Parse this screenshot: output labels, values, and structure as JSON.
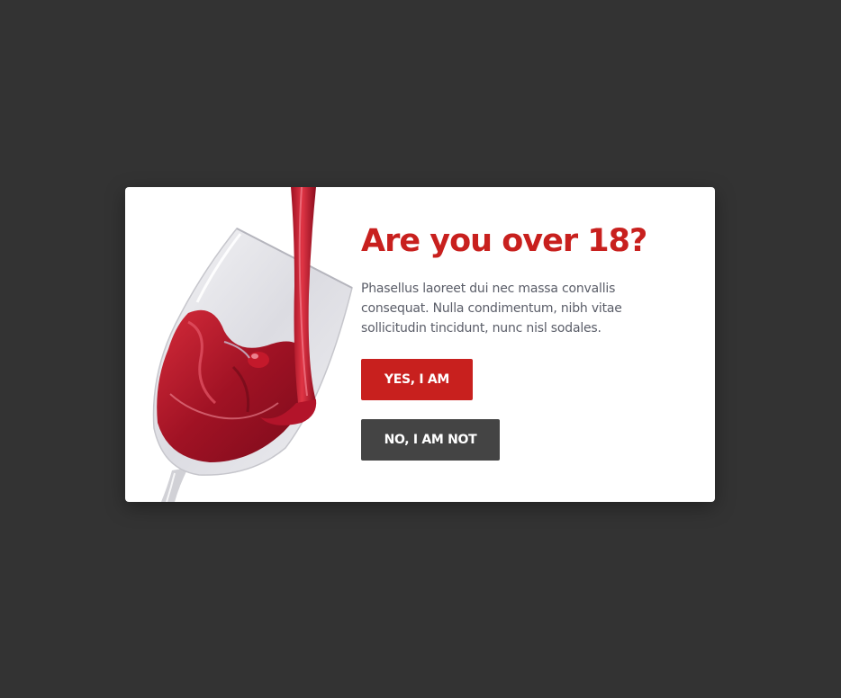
{
  "modal": {
    "image_name": "red-wine-glass-image",
    "title": "Are you over 18?",
    "text": "Phasellus laoreet dui nec massa convallis consequat. Nulla condimentum, nibh vitae sollicitudin tincidunt, nunc nisl sodales.",
    "yes_label": "YES, I AM",
    "no_label": "NO, I AM NOT"
  },
  "colors": {
    "backdrop": "#333333",
    "modal_background": "#ffffff",
    "accent_red": "#c8201e",
    "dark_button": "#444444",
    "body_text": "#5a5d68"
  }
}
